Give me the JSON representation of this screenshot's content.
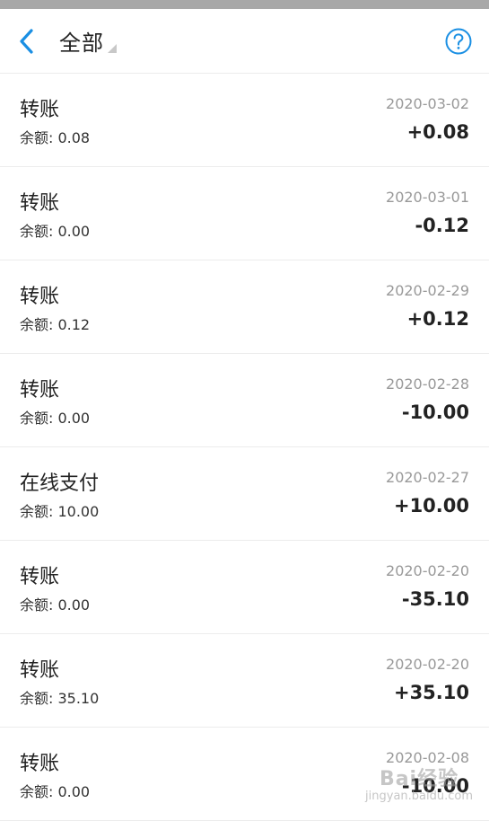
{
  "header": {
    "back_icon": "chevron-left-icon",
    "filter_label": "全部",
    "help_icon": "question-circle-icon",
    "accent_color": "#1a8fe3"
  },
  "records": [
    {
      "title": "转账",
      "balance": "余额: 0.08",
      "date": "2020-03-02",
      "amount": "+0.08"
    },
    {
      "title": "转账",
      "balance": "余额: 0.00",
      "date": "2020-03-01",
      "amount": "-0.12"
    },
    {
      "title": "转账",
      "balance": "余额: 0.12",
      "date": "2020-02-29",
      "amount": "+0.12"
    },
    {
      "title": "转账",
      "balance": "余额: 0.00",
      "date": "2020-02-28",
      "amount": "-10.00"
    },
    {
      "title": "在线支付",
      "balance": "余额: 10.00",
      "date": "2020-02-27",
      "amount": "+10.00"
    },
    {
      "title": "转账",
      "balance": "余额: 0.00",
      "date": "2020-02-20",
      "amount": "-35.10"
    },
    {
      "title": "转账",
      "balance": "余额: 35.10",
      "date": "2020-02-20",
      "amount": "+35.10"
    },
    {
      "title": "转账",
      "balance": "余额: 0.00",
      "date": "2020-02-08",
      "amount": "-10.00"
    }
  ],
  "watermark": {
    "brand": "Bai经验",
    "domain": "jingyan.baidu.com"
  }
}
